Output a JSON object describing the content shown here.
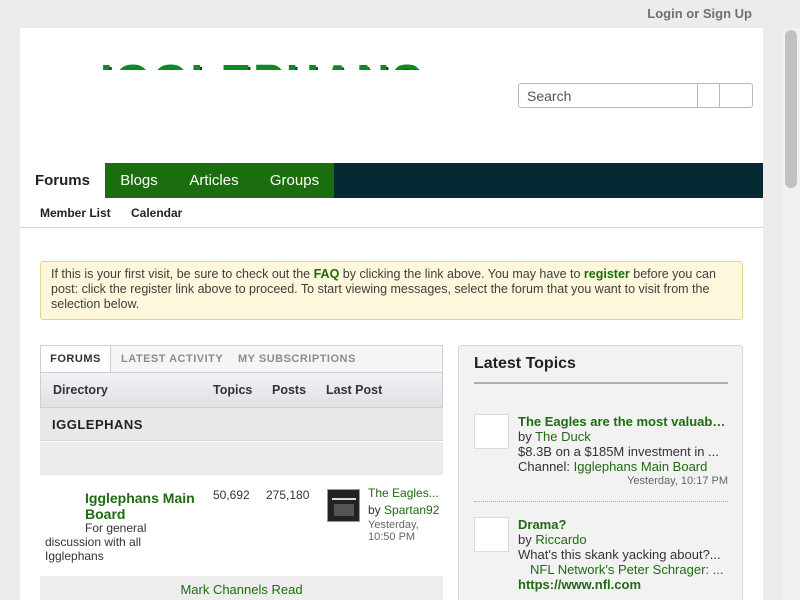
{
  "topbar": {
    "login_label": "Login or Sign Up"
  },
  "header": {
    "logo_text": "IGGLEPHANS",
    "search_placeholder": "Search"
  },
  "nav": {
    "tabs": [
      {
        "label": "Forums",
        "active": true
      },
      {
        "label": "Blogs"
      },
      {
        "label": "Articles"
      },
      {
        "label": "Groups"
      }
    ],
    "subnav": [
      "Member List",
      "Calendar"
    ]
  },
  "notice": {
    "part1": "If this is your first visit, be sure to check out the ",
    "faq": "FAQ",
    "part2": " by clicking the link above. You may have to ",
    "register": "register",
    "part3": " before you can post: click the register link above to proceed. To start viewing messages, select the forum that you want to visit from the selection below."
  },
  "forum_tabs": [
    "FORUMS",
    "LATEST ACTIVITY",
    "MY SUBSCRIPTIONS"
  ],
  "columns": {
    "directory": "Directory",
    "topics": "Topics",
    "posts": "Posts",
    "last_post": "Last Post"
  },
  "section_title": "IGGLEPHANS",
  "forum": {
    "name": "Igglephans Main Board",
    "description_line1": "For general",
    "description_line2": "discussion with all Igglephans",
    "topics": "50,692",
    "posts": "275,180",
    "last_post_title": "The Eagles...",
    "last_post_by_prefix": "by ",
    "last_post_user": "Spartan92",
    "last_post_date": "Yesterday, 10:50 PM"
  },
  "mark_read_label": "Mark Channels Read",
  "latest": {
    "title": "Latest Topics",
    "items": [
      {
        "title": "The Eagles are the most valuable...",
        "by_prefix": "by ",
        "user": "The Duck",
        "snippet": "$8.3B on a $185M investment in ...",
        "channel_prefix": "Channel: ",
        "channel": "Igglephans Main Board",
        "date": "Yesterday, 10:17 PM"
      },
      {
        "title": "Drama?",
        "by_prefix": "by ",
        "user": "Riccardo",
        "snippet": "What's this skank yacking about?...",
        "link_line": "NFL Network's Peter Schrager: ...",
        "url": "https://www.nfl.com"
      }
    ]
  }
}
